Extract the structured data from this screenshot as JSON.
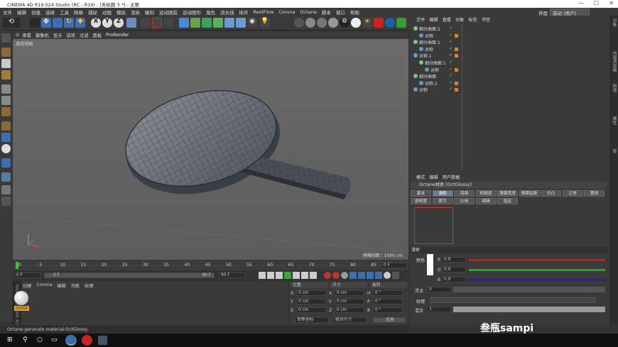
{
  "window": {
    "title": "CINEMA 4D R19.024 Studio (RC - R19) - [未标题 3 *] - 主要"
  },
  "menubar": {
    "items": [
      "文件",
      "编辑",
      "创建",
      "选择",
      "工具",
      "网格",
      "捕捉",
      "动画",
      "模拟",
      "渲染",
      "雕刻",
      "运动跟踪",
      "运动图形",
      "角色",
      "流水线",
      "插件",
      "RealFlow",
      "Corona",
      "Octane",
      "脚本",
      "窗口",
      "帮助"
    ]
  },
  "layout": {
    "label": "界面",
    "value": "启动 (用户)"
  },
  "viewport": {
    "menu": [
      "查看",
      "摄像机",
      "显示",
      "选项",
      "过滤",
      "面板",
      "ProRender"
    ],
    "label": "透视视图",
    "grid_label": "网格间距 : 1000 cm"
  },
  "timeline": {
    "ticks": [
      "0",
      "5",
      "10",
      "15",
      "20",
      "25",
      "30",
      "35",
      "40",
      "45",
      "50",
      "55",
      "60",
      "65",
      "70",
      "75",
      "80",
      "85",
      "90"
    ],
    "end_frame": "0 F"
  },
  "transport": {
    "start": "0 F",
    "current": "0 F",
    "end_field": "90 F",
    "end_field2": "90 F"
  },
  "materials": {
    "menu": [
      "创建",
      "Corona",
      "编辑",
      "功能",
      "纹理"
    ],
    "items": [
      {
        "name": "OctGl"
      }
    ],
    "side_brand": "MAXON CINEMA 4D"
  },
  "coords": {
    "headers": [
      "位置",
      "尺寸",
      "旋转"
    ],
    "rows": [
      {
        "axis": "X",
        "pos": "0 cm",
        "axis2": "X",
        "size": "0 cm",
        "axis3": "H",
        "rot": "0 °"
      },
      {
        "axis": "Y",
        "pos": "0 cm",
        "axis2": "Y",
        "size": "0 cm",
        "axis3": "P",
        "rot": "0 °"
      },
      {
        "axis": "Z",
        "pos": "0 cm",
        "axis2": "Z",
        "size": "0 cm",
        "axis3": "B",
        "rot": "0 °"
      }
    ],
    "mode1": "世界坐标",
    "mode2": "绝对尺寸",
    "apply": "应用"
  },
  "status": "Octane:generate material:OctGlossy",
  "objects": {
    "menu": [
      "文件",
      "编辑",
      "查看",
      "对象",
      "标签",
      "书签"
    ],
    "rows": [
      {
        "name": "细分曲面.2",
        "indent": 0
      },
      {
        "name": "对称",
        "indent": 1
      },
      {
        "name": "细分曲面.1",
        "indent": 0
      },
      {
        "name": "对称",
        "indent": 1
      },
      {
        "name": "对称.1",
        "indent": 0
      },
      {
        "name": "细分曲面.1",
        "indent": 1
      },
      {
        "name": "对称",
        "indent": 2
      },
      {
        "name": "细分曲面",
        "indent": 0
      },
      {
        "name": "对称.2",
        "indent": 1
      },
      {
        "name": "对称",
        "indent": 0
      }
    ]
  },
  "attributes": {
    "menu": [
      "模式",
      "编辑",
      "用户数据"
    ],
    "title": "Octane材质 [OctGlossy]",
    "tabs_row1": [
      "基本",
      "漫射",
      "镜面",
      "粗糙度",
      "薄膜宽度",
      "薄膜指数",
      "凹凸",
      "正常",
      "置换"
    ],
    "tabs_row2": [
      "透明度",
      "索引",
      "公用",
      "编辑",
      "指定"
    ],
    "section": "漫射",
    "color_label": "颜色",
    "r": "0.9",
    "g": "0.9",
    "b": "0.9",
    "rl": "R",
    "gl": "G",
    "bl": "B",
    "float_label": "浮点",
    "float_value": "0",
    "tex_label": "纹理",
    "mix_label": "混合",
    "mix_value": "1."
  },
  "right_strip": [
    "对象",
    "内容浏览器",
    "构造",
    "属性",
    "层"
  ],
  "watermark": "叁瓶sampi"
}
